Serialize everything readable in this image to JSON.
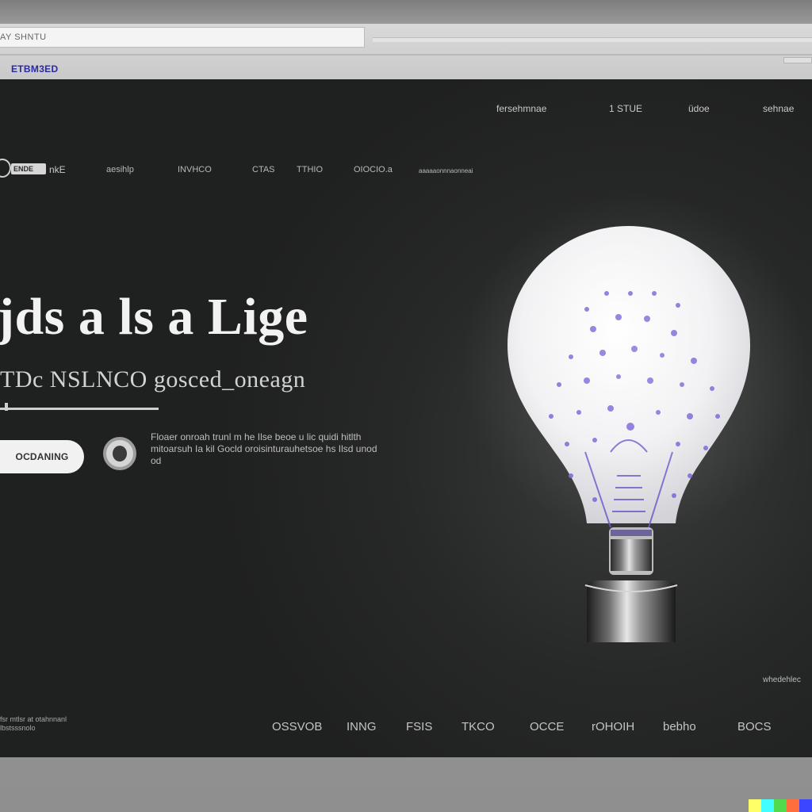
{
  "browser": {
    "address": "AY SHNTU",
    "bookmark": "ETBM3ED"
  },
  "topnav": [
    "fersehmnae",
    "1 STUE",
    "üdoe",
    "sehnae"
  ],
  "logo": {
    "text": "ENDE",
    "suffix": "nkE"
  },
  "mainnav": [
    "aesihlp",
    "INVHCO",
    "CTAS",
    "TTHIO",
    "OIOCIO.a",
    "aaaaaonnnaonneai"
  ],
  "hero": {
    "title": "jds a ls a Lige",
    "subtitle": "TDc NSLNCO gosced_oneagn",
    "cta_label": "OCDANING",
    "description": "Floaer onroah trunl m he Ilse beoe u lic quidi hitlth mitoarsuh Ia kil Gocld oroisinturauhetsoe hs Ilsd unod od"
  },
  "side_label": "whedehlec",
  "footer": {
    "copy": "fsr mtlsr at otahnnanl lbstsssnolo",
    "nav": [
      "OSSVOB",
      "INNG",
      "FSIS",
      "TKCO",
      "OCCE",
      "rOHOIH",
      "bebho",
      "BOCS"
    ]
  },
  "colors": {
    "background": "#262727",
    "text": "#f2f2f2",
    "accent": "#6a5ad8",
    "button": "#f1f1f1"
  },
  "strip_colors": [
    "#ffff66",
    "#42ffff",
    "#51da4c",
    "#ff6e3c",
    "#3c46ff"
  ]
}
